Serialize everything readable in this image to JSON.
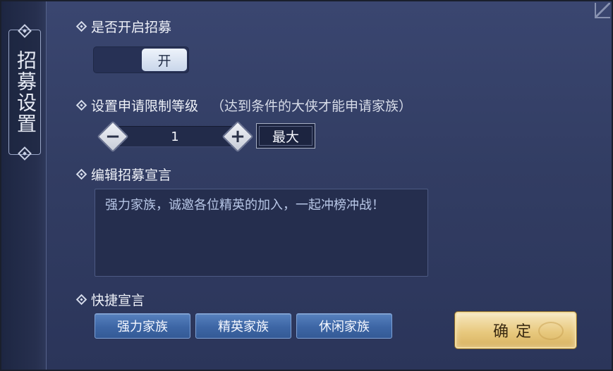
{
  "side_tab": {
    "title": "招募设置"
  },
  "recruit_toggle": {
    "label": "是否开启招募",
    "state": "开"
  },
  "level_limit": {
    "label": "设置申请限制等级",
    "hint": "（达到条件的大侠才能申请家族）",
    "value": "1",
    "minus": "−",
    "plus": "+",
    "max_label": "最大"
  },
  "manifesto": {
    "label": "编辑招募宣言",
    "text": "强力家族，诚邀各位精英的加入，一起冲榜冲战！"
  },
  "quick": {
    "label": "快捷宣言",
    "options": [
      "强力家族",
      "精英家族",
      "休闲家族"
    ]
  },
  "confirm_label": "确定",
  "colors": {
    "panel": "#323d63",
    "quick_button": "#3d66a5",
    "confirm_button": "#e8c97f",
    "text": "#eef1f8",
    "manifesto_text": "#b7c6e6"
  }
}
